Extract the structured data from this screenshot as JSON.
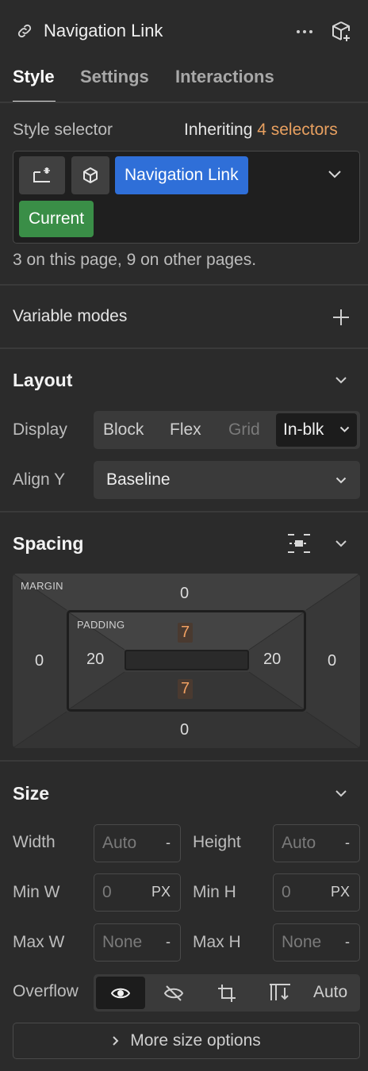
{
  "header": {
    "title": "Navigation Link",
    "tabs": [
      {
        "label": "Style"
      },
      {
        "label": "Settings"
      },
      {
        "label": "Interactions"
      }
    ]
  },
  "selector": {
    "label": "Style selector",
    "inheriting": "Inheriting",
    "inheriting_count": "4 selectors",
    "chips": {
      "primary": "Navigation Link",
      "state": "Current"
    },
    "usage": "3 on this page, 9 on other pages."
  },
  "variable_modes": {
    "label": "Variable modes"
  },
  "layout": {
    "title": "Layout",
    "display_label": "Display",
    "display_options": [
      "Block",
      "Flex",
      "Grid"
    ],
    "display_selected": "In-blk",
    "align_label": "Align Y",
    "align_value": "Baseline"
  },
  "spacing": {
    "title": "Spacing",
    "margin_label": "MARGIN",
    "padding_label": "PADDING",
    "margin": {
      "top": "0",
      "right": "0",
      "bottom": "0",
      "left": "0"
    },
    "padding": {
      "top": "7",
      "right": "20",
      "bottom": "7",
      "left": "20"
    }
  },
  "size": {
    "title": "Size",
    "width_label": "Width",
    "width_value": "Auto",
    "width_unit": "-",
    "height_label": "Height",
    "height_value": "Auto",
    "height_unit": "-",
    "minw_label": "Min W",
    "minw_value": "0",
    "minw_unit": "PX",
    "minh_label": "Min H",
    "minh_value": "0",
    "minh_unit": "PX",
    "maxw_label": "Max W",
    "maxw_value": "None",
    "maxw_unit": "-",
    "maxh_label": "Max H",
    "maxh_value": "None",
    "maxh_unit": "-",
    "overflow_label": "Overflow",
    "overflow_auto": "Auto",
    "more_label": "More size options"
  },
  "colors": {
    "accent_orange": "#e8a060",
    "chip_blue": "#2f6fd8",
    "chip_green": "#3a8e47"
  }
}
